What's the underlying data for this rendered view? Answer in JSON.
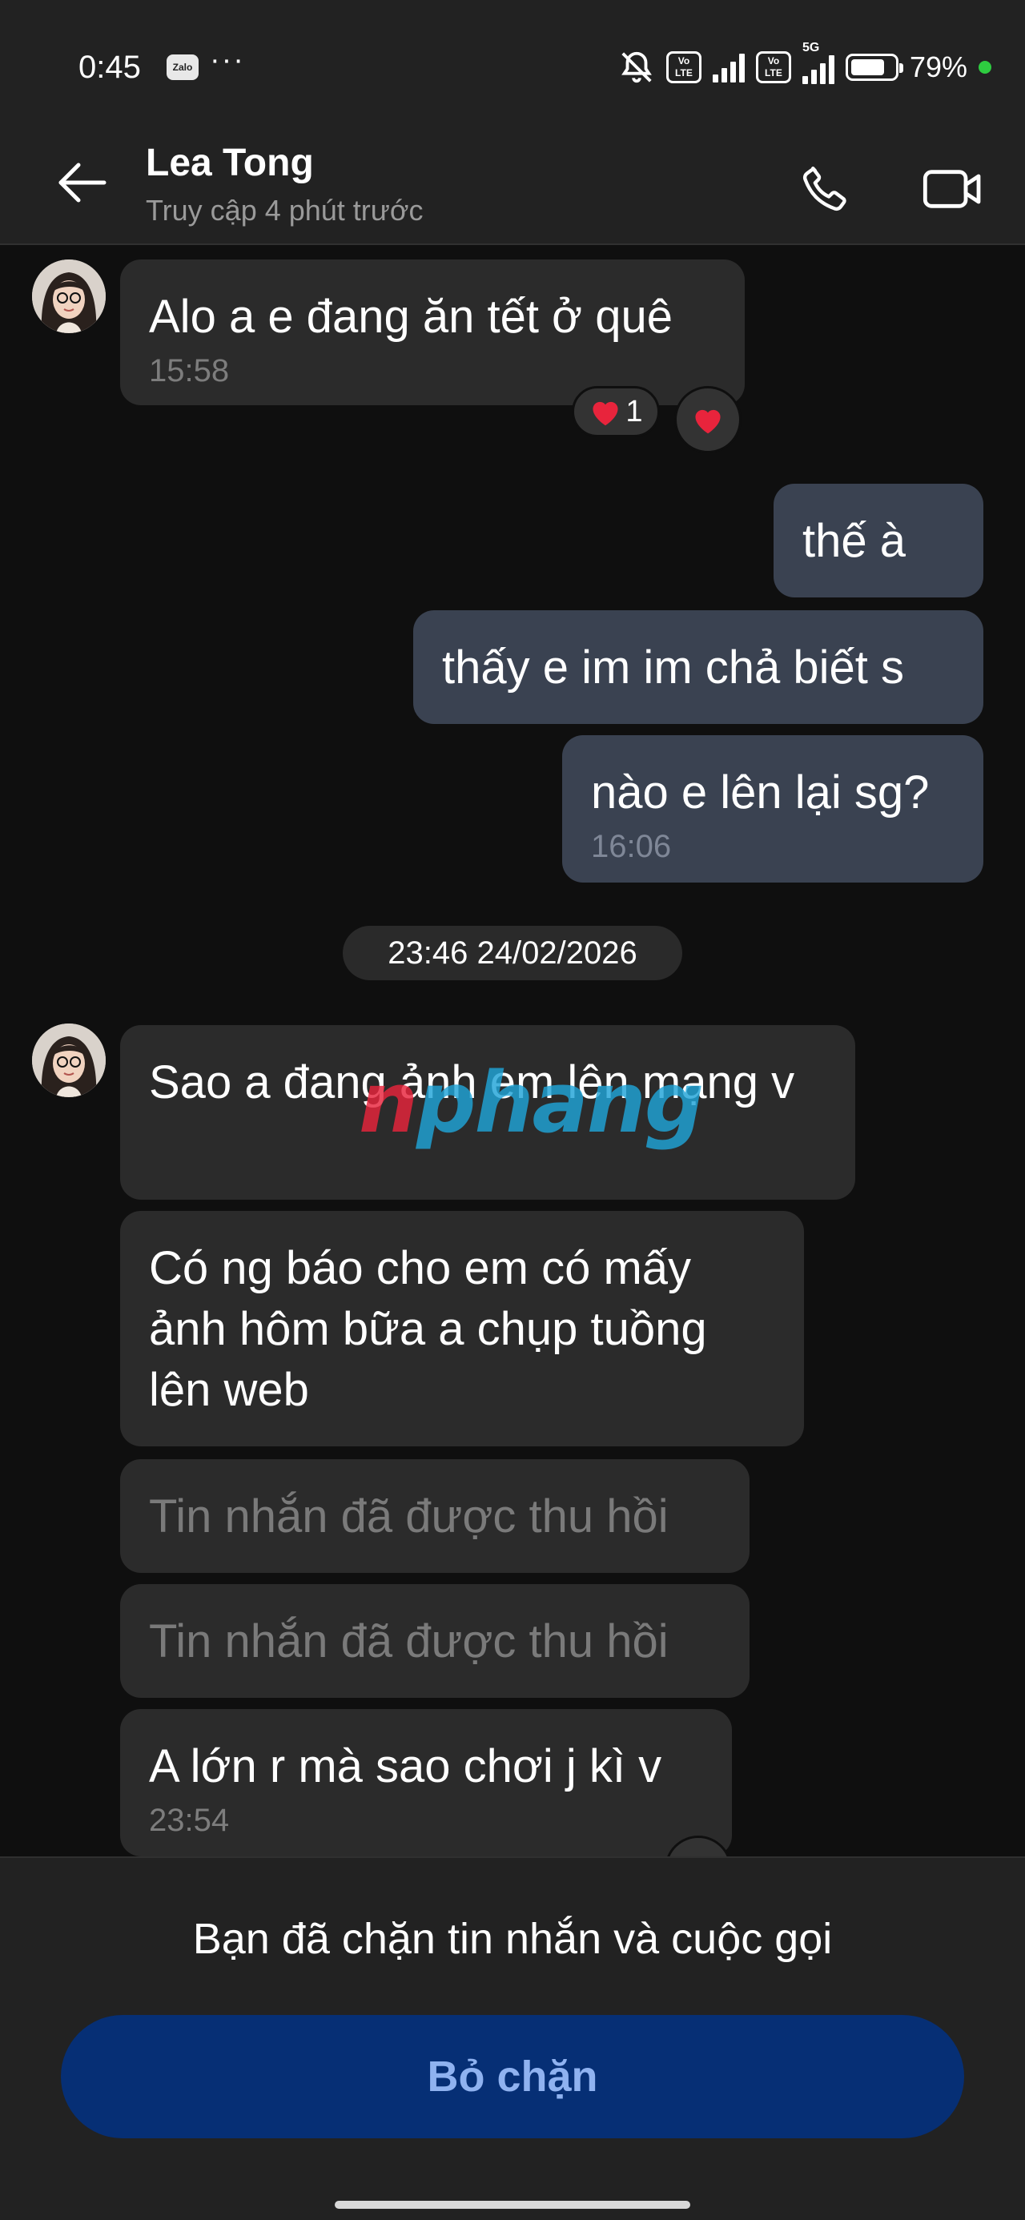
{
  "status_bar": {
    "time": "0:45",
    "zalo_badge": "Zalo",
    "more": "···",
    "volte1": "Vo\nLTE",
    "volte2": "Vo\nLTE",
    "network": "5G",
    "battery_percent": "79%",
    "battery_level": 0.79,
    "icons": [
      "mute-bell-icon",
      "signal-icon",
      "battery-icon"
    ]
  },
  "header": {
    "name": "Lea Tong",
    "last_seen": "Truy cập 4 phút trước",
    "icons": [
      "back-arrow-icon",
      "phone-icon",
      "video-call-icon"
    ]
  },
  "messages": [
    {
      "side": "in",
      "text": "Alo a e đang ăn tết ở quê",
      "time": "15:58"
    },
    {
      "side": "out",
      "text": "thế à",
      "time": ""
    },
    {
      "side": "out",
      "text": "thấy e im im chả biết s",
      "time": ""
    },
    {
      "side": "out",
      "text": "nào e lên lại sg?",
      "time": "16:06"
    },
    {
      "side": "in",
      "text": "Sao a đang ảnh em lên mạng v",
      "time": ""
    },
    {
      "side": "in",
      "text": "Có ng báo cho em có mấy ảnh hôm bữa a chụp tuồng lên web",
      "time": ""
    },
    {
      "side": "in",
      "text": "Tin nhắn đã được thu hồi",
      "recalled": true
    },
    {
      "side": "in",
      "text": "Tin nhắn đã được thu hồi",
      "recalled": true
    },
    {
      "side": "in",
      "text": "A lớn r mà sao chơi j kì v",
      "time": "23:54"
    }
  ],
  "reactions": {
    "count": "1",
    "heart_color": "#e8243c"
  },
  "date_separator": "23:46 24/02/2026",
  "watermark": {
    "part1": "n",
    "part2": "phang"
  },
  "blocked_bar": {
    "message": "Bạn đã chặn tin nhắn và cuộc gọi",
    "unblock_label": "Bỏ chặn"
  },
  "colors": {
    "header_bg": "#222222",
    "chat_bg": "#0f0f0f",
    "incoming_bubble": "#2b2b2b",
    "outgoing_bubble": "#3a4251",
    "unblock_button": "#062f75",
    "unblock_text": "#8fb2f0"
  }
}
